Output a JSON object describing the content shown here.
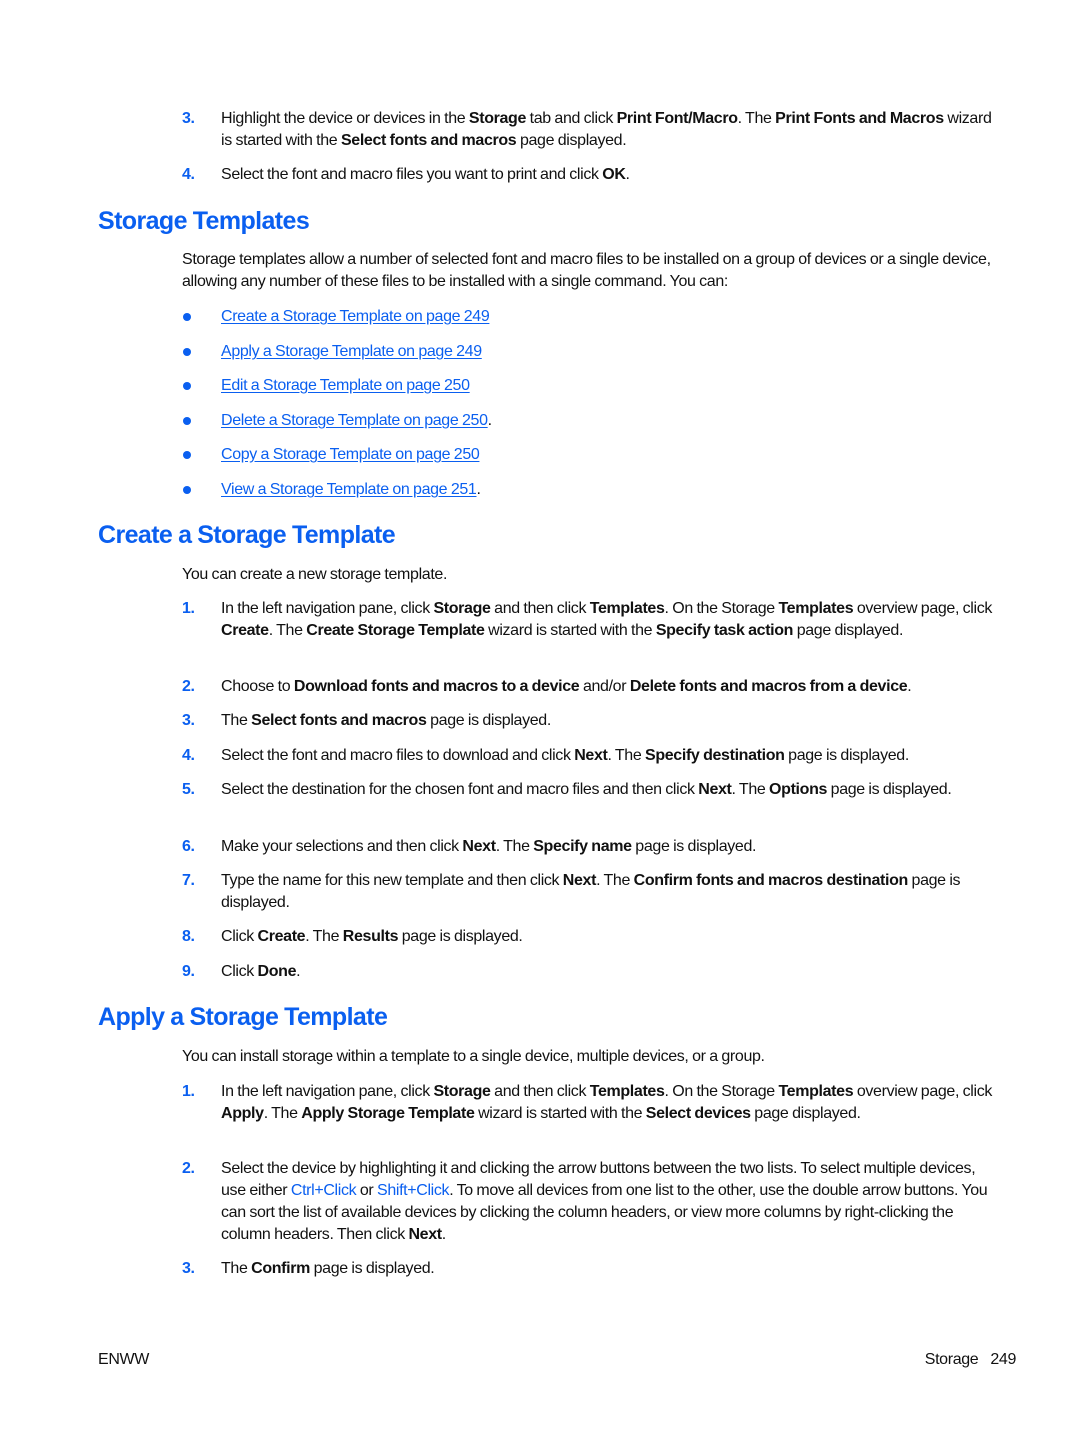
{
  "intro_steps": [
    {
      "num": "3.",
      "parts": [
        {
          "t": "Highlight the device or devices in the "
        },
        {
          "t": "Storage",
          "b": true
        },
        {
          "t": " tab and click "
        },
        {
          "t": "Print Font/Macro",
          "b": true
        },
        {
          "t": ". The "
        },
        {
          "t": "Print Fonts and Macros",
          "b": true
        },
        {
          "t": " wizard is started with the "
        },
        {
          "t": "Select fonts and macros",
          "b": true
        },
        {
          "t": " page displayed."
        }
      ]
    },
    {
      "num": "4.",
      "parts": [
        {
          "t": "Select the font and macro files you want to print and click "
        },
        {
          "t": "OK",
          "b": true
        },
        {
          "t": "."
        }
      ]
    }
  ],
  "storage_templates": {
    "heading": "Storage Templates",
    "intro": "Storage templates allow a number of selected font and macro files to be installed on a group of devices or a single device, allowing any number of these files to be installed with a single command. You can:",
    "links": [
      {
        "label": "Create a Storage Template on page 249",
        "suffix": ""
      },
      {
        "label": "Apply a Storage Template on page 249",
        "suffix": ""
      },
      {
        "label": "Edit a Storage Template on page 250",
        "suffix": ""
      },
      {
        "label": "Delete a Storage Template on page 250",
        "suffix": "."
      },
      {
        "label": "Copy a Storage Template on page 250",
        "suffix": ""
      },
      {
        "label": "View a Storage Template on page 251",
        "suffix": "."
      }
    ]
  },
  "create_template": {
    "heading": "Create a Storage Template",
    "intro": "You can create a new storage template.",
    "steps": [
      {
        "num": "1.",
        "parts": [
          {
            "t": "In the left navigation pane, click "
          },
          {
            "t": "Storage",
            "b": true
          },
          {
            "t": " and then click "
          },
          {
            "t": "Templates",
            "b": true
          },
          {
            "t": ". On the Storage "
          },
          {
            "t": "Templates",
            "b": true
          },
          {
            "t": " overview page, click "
          },
          {
            "t": "Create",
            "b": true
          },
          {
            "t": ". The "
          },
          {
            "t": "Create Storage Template",
            "b": true
          },
          {
            "t": " wizard is started with the "
          },
          {
            "t": "Specify task action",
            "b": true
          },
          {
            "t": " page displayed."
          }
        ]
      },
      {
        "num": "2.",
        "parts": [
          {
            "t": "Choose to "
          },
          {
            "t": "Download fonts and macros to a device",
            "b": true
          },
          {
            "t": " and/or "
          },
          {
            "t": "Delete fonts and macros from a device",
            "b": true
          },
          {
            "t": "."
          }
        ]
      },
      {
        "num": "3.",
        "parts": [
          {
            "t": "The "
          },
          {
            "t": "Select fonts and macros",
            "b": true
          },
          {
            "t": " page is displayed."
          }
        ]
      },
      {
        "num": "4.",
        "parts": [
          {
            "t": "Select the font and macro files to download and click "
          },
          {
            "t": "Next",
            "b": true
          },
          {
            "t": ". The "
          },
          {
            "t": "Specify destination",
            "b": true
          },
          {
            "t": " page is displayed."
          }
        ]
      },
      {
        "num": "5.",
        "parts": [
          {
            "t": "Select the destination for the chosen font and macro files and then click "
          },
          {
            "t": "Next",
            "b": true
          },
          {
            "t": ". The "
          },
          {
            "t": "Options",
            "b": true
          },
          {
            "t": " page is displayed."
          }
        ]
      },
      {
        "num": "6.",
        "parts": [
          {
            "t": "Make your selections and then click "
          },
          {
            "t": "Next",
            "b": true
          },
          {
            "t": ". The "
          },
          {
            "t": "Specify name",
            "b": true
          },
          {
            "t": " page is displayed."
          }
        ]
      },
      {
        "num": "7.",
        "parts": [
          {
            "t": "Type the name for this new template and then click "
          },
          {
            "t": "Next",
            "b": true
          },
          {
            "t": ". The "
          },
          {
            "t": "Confirm fonts and macros destination",
            "b": true
          },
          {
            "t": " page is displayed."
          }
        ]
      },
      {
        "num": "8.",
        "parts": [
          {
            "t": "Click "
          },
          {
            "t": "Create",
            "b": true
          },
          {
            "t": ". The "
          },
          {
            "t": "Results",
            "b": true
          },
          {
            "t": " page is displayed."
          }
        ]
      },
      {
        "num": "9.",
        "parts": [
          {
            "t": "Click "
          },
          {
            "t": "Done",
            "b": true
          },
          {
            "t": "."
          }
        ]
      }
    ]
  },
  "apply_template": {
    "heading": "Apply a Storage Template",
    "intro": "You can install storage within a template to a single device, multiple devices, or a group.",
    "steps": [
      {
        "num": "1.",
        "parts": [
          {
            "t": "In the left navigation pane, click "
          },
          {
            "t": "Storage",
            "b": true
          },
          {
            "t": " and then click "
          },
          {
            "t": "Templates",
            "b": true
          },
          {
            "t": ". On the Storage "
          },
          {
            "t": "Templates",
            "b": true
          },
          {
            "t": " overview page, click "
          },
          {
            "t": "Apply",
            "b": true
          },
          {
            "t": ". The "
          },
          {
            "t": "Apply Storage Template",
            "b": true
          },
          {
            "t": " wizard is started with the "
          },
          {
            "t": "Select devices",
            "b": true
          },
          {
            "t": " page displayed."
          }
        ]
      },
      {
        "num": "2.",
        "parts": [
          {
            "t": "Select the device by highlighting it and clicking the arrow buttons between the two lists. To select multiple devices, use either "
          },
          {
            "t": "Ctrl+Click",
            "blue": true
          },
          {
            "t": " or "
          },
          {
            "t": "Shift+Click",
            "blue": true
          },
          {
            "t": ". To move all devices from one list to the other, use the double arrow buttons. You can sort the list of available devices by clicking the column headers, or view more columns by right-clicking the column headers. Then click "
          },
          {
            "t": "Next",
            "b": true
          },
          {
            "t": "."
          }
        ]
      },
      {
        "num": "3.",
        "parts": [
          {
            "t": "The "
          },
          {
            "t": "Confirm",
            "b": true
          },
          {
            "t": " page is displayed."
          }
        ]
      }
    ]
  },
  "footer": {
    "left": "ENWW",
    "section": "Storage",
    "page_number": "249"
  },
  "colors": {
    "accent": "#0a5ff0",
    "text": "#111111"
  }
}
